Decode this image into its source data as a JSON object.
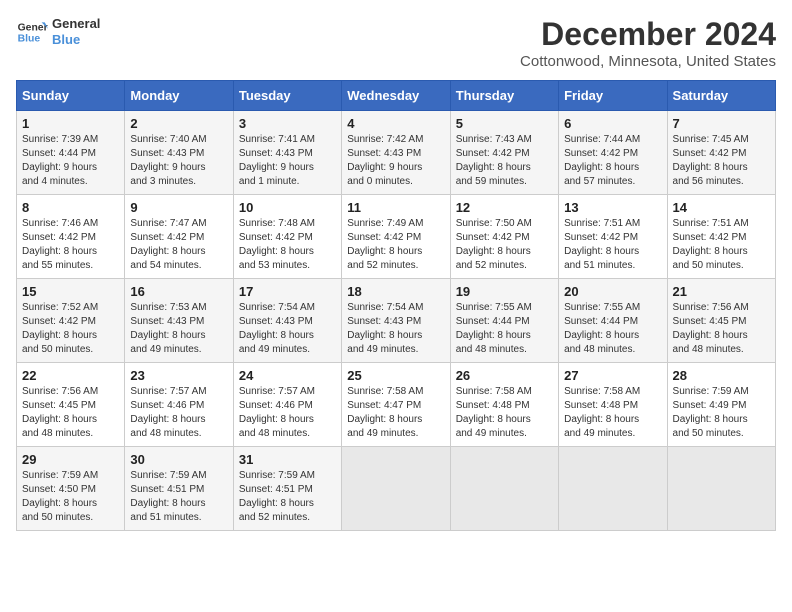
{
  "header": {
    "logo_line1": "General",
    "logo_line2": "Blue",
    "title": "December 2024",
    "subtitle": "Cottonwood, Minnesota, United States"
  },
  "weekdays": [
    "Sunday",
    "Monday",
    "Tuesday",
    "Wednesday",
    "Thursday",
    "Friday",
    "Saturday"
  ],
  "weeks": [
    [
      {
        "day": "1",
        "info": "Sunrise: 7:39 AM\nSunset: 4:44 PM\nDaylight: 9 hours\nand 4 minutes."
      },
      {
        "day": "2",
        "info": "Sunrise: 7:40 AM\nSunset: 4:43 PM\nDaylight: 9 hours\nand 3 minutes."
      },
      {
        "day": "3",
        "info": "Sunrise: 7:41 AM\nSunset: 4:43 PM\nDaylight: 9 hours\nand 1 minute."
      },
      {
        "day": "4",
        "info": "Sunrise: 7:42 AM\nSunset: 4:43 PM\nDaylight: 9 hours\nand 0 minutes."
      },
      {
        "day": "5",
        "info": "Sunrise: 7:43 AM\nSunset: 4:42 PM\nDaylight: 8 hours\nand 59 minutes."
      },
      {
        "day": "6",
        "info": "Sunrise: 7:44 AM\nSunset: 4:42 PM\nDaylight: 8 hours\nand 57 minutes."
      },
      {
        "day": "7",
        "info": "Sunrise: 7:45 AM\nSunset: 4:42 PM\nDaylight: 8 hours\nand 56 minutes."
      }
    ],
    [
      {
        "day": "8",
        "info": "Sunrise: 7:46 AM\nSunset: 4:42 PM\nDaylight: 8 hours\nand 55 minutes."
      },
      {
        "day": "9",
        "info": "Sunrise: 7:47 AM\nSunset: 4:42 PM\nDaylight: 8 hours\nand 54 minutes."
      },
      {
        "day": "10",
        "info": "Sunrise: 7:48 AM\nSunset: 4:42 PM\nDaylight: 8 hours\nand 53 minutes."
      },
      {
        "day": "11",
        "info": "Sunrise: 7:49 AM\nSunset: 4:42 PM\nDaylight: 8 hours\nand 52 minutes."
      },
      {
        "day": "12",
        "info": "Sunrise: 7:50 AM\nSunset: 4:42 PM\nDaylight: 8 hours\nand 52 minutes."
      },
      {
        "day": "13",
        "info": "Sunrise: 7:51 AM\nSunset: 4:42 PM\nDaylight: 8 hours\nand 51 minutes."
      },
      {
        "day": "14",
        "info": "Sunrise: 7:51 AM\nSunset: 4:42 PM\nDaylight: 8 hours\nand 50 minutes."
      }
    ],
    [
      {
        "day": "15",
        "info": "Sunrise: 7:52 AM\nSunset: 4:42 PM\nDaylight: 8 hours\nand 50 minutes."
      },
      {
        "day": "16",
        "info": "Sunrise: 7:53 AM\nSunset: 4:43 PM\nDaylight: 8 hours\nand 49 minutes."
      },
      {
        "day": "17",
        "info": "Sunrise: 7:54 AM\nSunset: 4:43 PM\nDaylight: 8 hours\nand 49 minutes."
      },
      {
        "day": "18",
        "info": "Sunrise: 7:54 AM\nSunset: 4:43 PM\nDaylight: 8 hours\nand 49 minutes."
      },
      {
        "day": "19",
        "info": "Sunrise: 7:55 AM\nSunset: 4:44 PM\nDaylight: 8 hours\nand 48 minutes."
      },
      {
        "day": "20",
        "info": "Sunrise: 7:55 AM\nSunset: 4:44 PM\nDaylight: 8 hours\nand 48 minutes."
      },
      {
        "day": "21",
        "info": "Sunrise: 7:56 AM\nSunset: 4:45 PM\nDaylight: 8 hours\nand 48 minutes."
      }
    ],
    [
      {
        "day": "22",
        "info": "Sunrise: 7:56 AM\nSunset: 4:45 PM\nDaylight: 8 hours\nand 48 minutes."
      },
      {
        "day": "23",
        "info": "Sunrise: 7:57 AM\nSunset: 4:46 PM\nDaylight: 8 hours\nand 48 minutes."
      },
      {
        "day": "24",
        "info": "Sunrise: 7:57 AM\nSunset: 4:46 PM\nDaylight: 8 hours\nand 48 minutes."
      },
      {
        "day": "25",
        "info": "Sunrise: 7:58 AM\nSunset: 4:47 PM\nDaylight: 8 hours\nand 49 minutes."
      },
      {
        "day": "26",
        "info": "Sunrise: 7:58 AM\nSunset: 4:48 PM\nDaylight: 8 hours\nand 49 minutes."
      },
      {
        "day": "27",
        "info": "Sunrise: 7:58 AM\nSunset: 4:48 PM\nDaylight: 8 hours\nand 49 minutes."
      },
      {
        "day": "28",
        "info": "Sunrise: 7:59 AM\nSunset: 4:49 PM\nDaylight: 8 hours\nand 50 minutes."
      }
    ],
    [
      {
        "day": "29",
        "info": "Sunrise: 7:59 AM\nSunset: 4:50 PM\nDaylight: 8 hours\nand 50 minutes."
      },
      {
        "day": "30",
        "info": "Sunrise: 7:59 AM\nSunset: 4:51 PM\nDaylight: 8 hours\nand 51 minutes."
      },
      {
        "day": "31",
        "info": "Sunrise: 7:59 AM\nSunset: 4:51 PM\nDaylight: 8 hours\nand 52 minutes."
      },
      {
        "day": "",
        "info": ""
      },
      {
        "day": "",
        "info": ""
      },
      {
        "day": "",
        "info": ""
      },
      {
        "day": "",
        "info": ""
      }
    ]
  ]
}
